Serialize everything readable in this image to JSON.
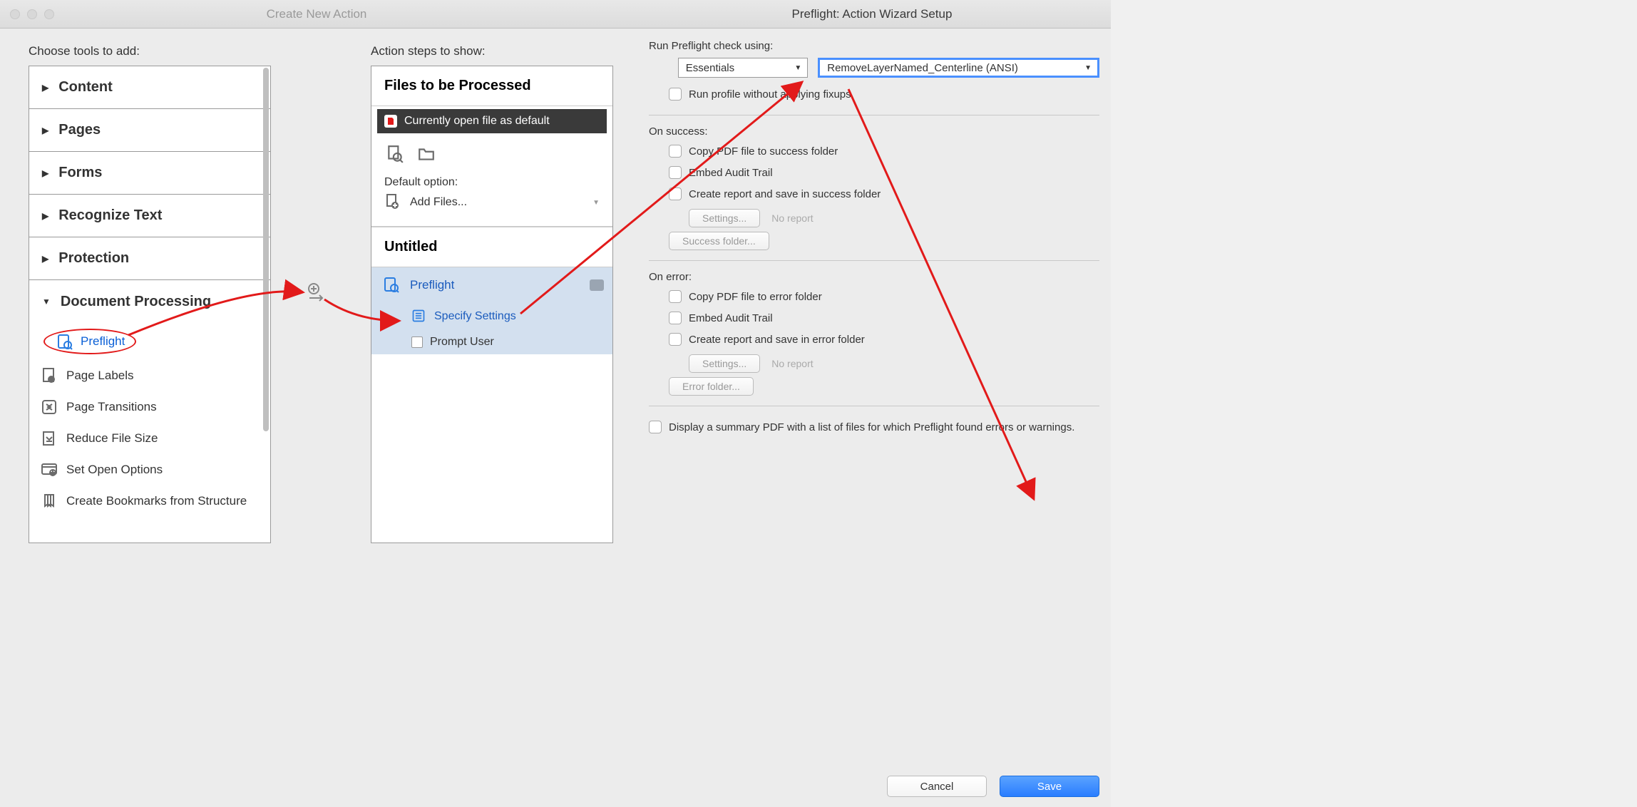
{
  "windowLeft": {
    "title": "Create New Action"
  },
  "windowRight": {
    "title": "Preflight: Action Wizard Setup"
  },
  "toolsLabel": "Choose tools to add:",
  "stepsLabel": "Action steps to show:",
  "categories": {
    "content": "Content",
    "pages": "Pages",
    "forms": "Forms",
    "recognize": "Recognize Text",
    "protection": "Protection",
    "docproc": "Document Processing"
  },
  "tools": {
    "preflight": "Preflight",
    "pageLabels": "Page Labels",
    "pageTransitions": "Page Transitions",
    "reduceFileSize": "Reduce File Size",
    "setOpenOptions": "Set Open Options",
    "createBookmarks": "Create Bookmarks from Structure"
  },
  "steps": {
    "filesHeader": "Files to be Processed",
    "currentlyOpen": "Currently open file as default",
    "defaultOption": "Default option:",
    "addFiles": "Add Files...",
    "untitledHeader": "Untitled",
    "preflight": "Preflight",
    "specifySettings": "Specify Settings",
    "promptUser": "Prompt User"
  },
  "preflightPanel": {
    "runLabel": "Run Preflight check using:",
    "library": "Essentials",
    "profile": "RemoveLayerNamed_Centerline (ANSI)",
    "runWithoutFixups": "Run profile without applying fixups",
    "onSuccess": "On success:",
    "copySuccess": "Copy PDF file to success folder",
    "embedAudit": "Embed Audit Trail",
    "createReportSuccess": "Create report and save in success folder",
    "settingsBtn": "Settings...",
    "noReport": "No report",
    "successFolderBtn": "Success folder...",
    "onError": "On error:",
    "copyError": "Copy PDF file to error folder",
    "createReportError": "Create report and save in error folder",
    "errorFolderBtn": "Error folder...",
    "displaySummary": "Display a summary PDF with a list of files for which Preflight found errors or warnings.",
    "cancel": "Cancel",
    "save": "Save"
  }
}
